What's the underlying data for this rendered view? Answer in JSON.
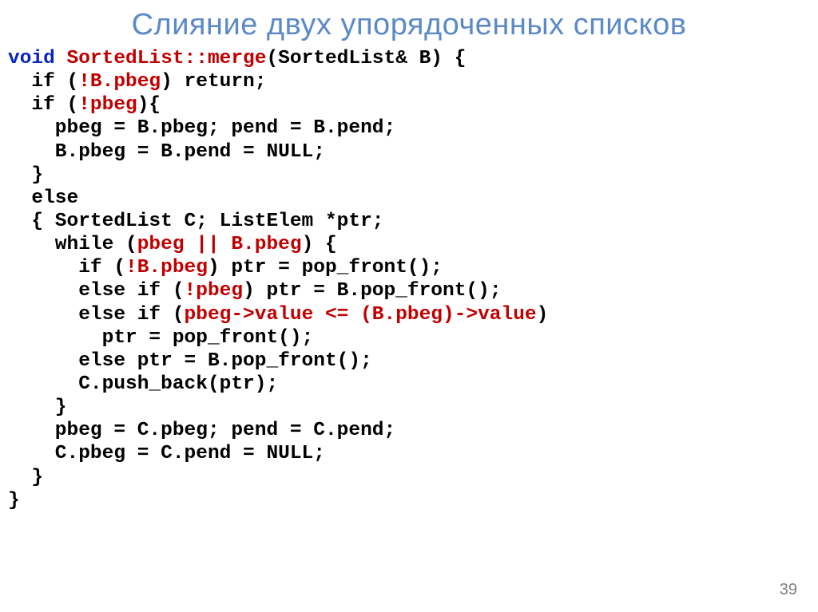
{
  "title": "Слияние двух упорядоченных списков",
  "page_number": "39",
  "code": {
    "l1": {
      "a": "void ",
      "b": "SortedList::merge",
      "c": "(SortedList& B) {"
    },
    "l2": {
      "a": "  if (",
      "b": "!B.pbeg",
      "c": ") return;"
    },
    "l3": {
      "a": "  if (",
      "b": "!pbeg",
      "c": "){"
    },
    "l4": "    pbeg = B.pbeg; pend = B.pend;",
    "l5": "    B.pbeg = B.pend = NULL;",
    "l6": "  }",
    "l7": "  else",
    "l8": "  { SortedList C; ListElem *ptr;",
    "l9": {
      "a": "    while (",
      "b": "pbeg || B.pbeg",
      "c": ") {"
    },
    "l10": {
      "a": "      if (",
      "b": "!B.pbeg",
      "c": ") ptr = pop_front();"
    },
    "l11": {
      "a": "      else if (",
      "b": "!pbeg",
      "c": ") ptr = B.pop_front();"
    },
    "l12": {
      "a": "      else if (",
      "b": "pbeg->value <= (B.pbeg)->value",
      "c": ")"
    },
    "l13": "        ptr = pop_front();",
    "l14": "      else ptr = B.pop_front();",
    "l15": "      C.push_back(ptr);",
    "l16": "    }",
    "l17": "    pbeg = C.pbeg; pend = C.pend;",
    "l18": "    C.pbeg = C.pend = NULL;",
    "l19": "  }",
    "l20": "}"
  }
}
